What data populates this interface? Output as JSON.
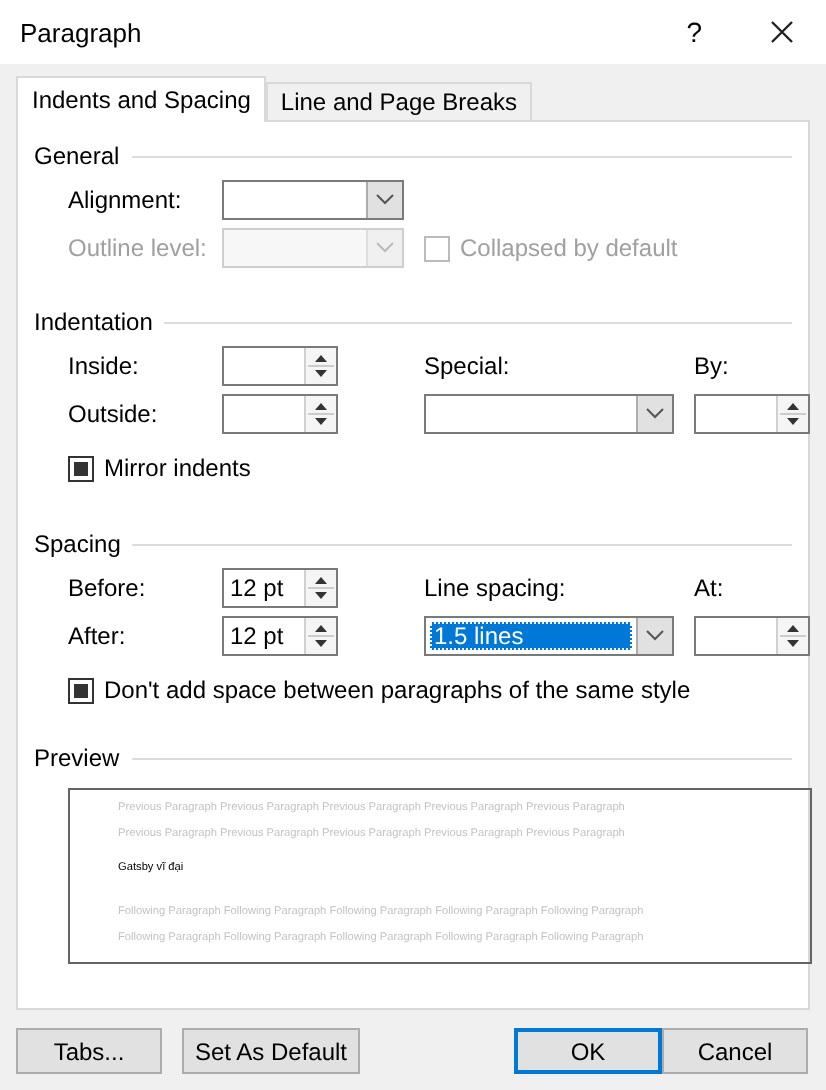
{
  "window": {
    "title": "Paragraph",
    "help": "?"
  },
  "tabs": [
    {
      "label": "Indents and Spacing",
      "selected": true
    },
    {
      "label": "Line and Page Breaks",
      "selected": false
    }
  ],
  "general": {
    "heading": "General",
    "alignment": {
      "label": "Alignment:",
      "field": {
        "kind": "dropdown",
        "disabled": false
      }
    },
    "outline_level": {
      "label": "Outline level:",
      "field": {
        "kind": "dropdown",
        "disabled": true
      }
    },
    "collapsed": {
      "label": "Collapsed by default",
      "checked": false,
      "disabled": true
    }
  },
  "indentation": {
    "heading": "Indentation",
    "inside": {
      "label": "Inside:",
      "field": {
        "kind": "spin",
        "disabled": false
      }
    },
    "outside": {
      "label": "Outside:",
      "field": {
        "kind": "spin",
        "disabled": false
      }
    },
    "special": {
      "label": "Special:",
      "field": {
        "kind": "dropdown",
        "disabled": false
      }
    },
    "by": {
      "label": "By:",
      "field": {
        "kind": "spin",
        "disabled": false
      }
    },
    "mirror": {
      "label": "Mirror indents",
      "checked": true,
      "disabled": false
    }
  },
  "spacing": {
    "heading": "Spacing",
    "before": {
      "label": "Before:",
      "field": {
        "kind": "spin",
        "value": "12 pt",
        "disabled": false
      }
    },
    "after": {
      "label": "After:",
      "field": {
        "kind": "spin",
        "value": "12 pt",
        "disabled": false
      }
    },
    "line_spacing": {
      "label": "Line spacing:",
      "field": {
        "kind": "dropdown",
        "value": "1.5 lines",
        "highlighted": true,
        "disabled": false
      }
    },
    "at": {
      "label": "At:",
      "field": {
        "kind": "spin",
        "disabled": false
      }
    },
    "dont_add": {
      "label": "Don't add space between paragraphs of the same style",
      "checked": true,
      "disabled": false
    }
  },
  "preview": {
    "heading": "Preview",
    "lines": [
      {
        "kind": "context",
        "text": "Previous Paragraph Previous Paragraph Previous Paragraph Previous Paragraph Previous Paragraph"
      },
      {
        "kind": "context",
        "text": "Previous Paragraph Previous Paragraph Previous Paragraph Previous Paragraph Previous Paragraph"
      },
      {
        "kind": "current",
        "text": "Gatsby vĩ đại"
      },
      {
        "kind": "context",
        "text": "Following Paragraph Following Paragraph Following Paragraph Following Paragraph Following Paragraph"
      },
      {
        "kind": "context",
        "text": "Following Paragraph Following Paragraph Following Paragraph Following Paragraph Following Paragraph"
      }
    ]
  },
  "buttons": [
    {
      "label": "Tabs...",
      "default": false
    },
    {
      "label": "Set As Default",
      "default": false
    },
    {
      "label": "OK",
      "default": true
    },
    {
      "label": "Cancel",
      "default": false
    }
  ]
}
